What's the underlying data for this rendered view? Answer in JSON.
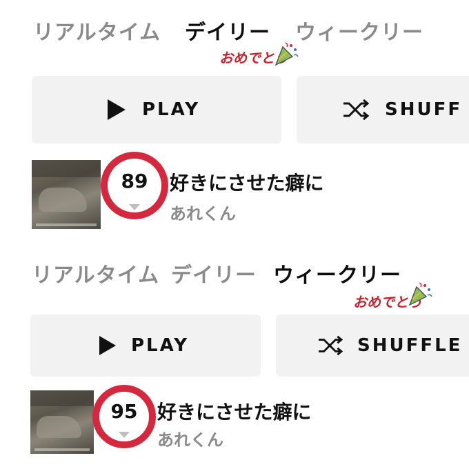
{
  "panels": [
    {
      "tabs": [
        "リアルタイム",
        "デイリー",
        "ウィークリー"
      ],
      "active_tab": "デイリー",
      "congrats_text": "おめでとう",
      "play_label": "PLAY",
      "shuffle_label": "SHUFF",
      "track": {
        "rank": "89",
        "title": "好きにさせた癖に",
        "artist": "あれくん"
      }
    },
    {
      "tabs": [
        "リアルタイム",
        "デイリー",
        "ウィークリー"
      ],
      "active_tab": "ウィークリー",
      "congrats_text": "おめでとう",
      "play_label": "PLAY",
      "shuffle_label": "SHUFFLE",
      "track": {
        "rank": "95",
        "title": "好きにさせた癖に",
        "artist": "あれくん"
      }
    }
  ],
  "colors": {
    "highlight_ring": "#d4283e",
    "congrats": "#c4232b",
    "inactive_tab": "#8a8a8a",
    "button_bg": "#f2f2f2"
  },
  "icons": {
    "play": "play-triangle",
    "shuffle": "shuffle-arrows",
    "party": "party-popper"
  }
}
